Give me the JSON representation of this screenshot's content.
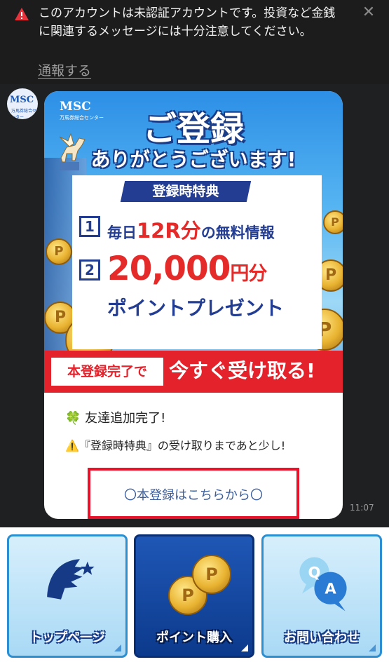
{
  "warning": {
    "message": "このアカウントは未認証アカウントです。投資など金銭に関連するメッセージには十分注意してください。",
    "report_link": "通報する",
    "icon": "warning-triangle-icon",
    "close_icon": "close-icon"
  },
  "chat": {
    "avatar": {
      "name": "MSC",
      "subtitle": "万馬券総合センター"
    },
    "banner": {
      "logo": "MSC",
      "logo_sub": "万馬券総合センター",
      "title": "ご登録",
      "subtitle": "ありがとうございます!",
      "perk_header": "登録時特典",
      "perk1_num": "1",
      "perk1_pre": "毎日",
      "perk1_highlight": "12R分",
      "perk1_post": "の無料情報",
      "perk2_num": "2",
      "perk2_amount": "20,000",
      "perk2_unit": "円分",
      "perk2_line2": "ポイントプレゼント",
      "cta_box": "本登録完了で",
      "cta_text": "今すぐ受け取る!",
      "coin_mark": "P"
    },
    "message_line1": "🍀 友達追加完了!",
    "message_line2": "⚠️『登録時特典』の受け取りまであと少し!",
    "register_button": "〇本登録はこちらから〇",
    "time": "11:07"
  },
  "menu": {
    "items": [
      {
        "label": "トップページ",
        "icon": "pegasus-logo-icon"
      },
      {
        "label": "ポイント購入",
        "icon": "coins-icon"
      },
      {
        "label": "お問い合わせ",
        "icon": "qa-bubbles-icon"
      }
    ]
  },
  "colors": {
    "banner_blue": "#2d8fe6",
    "brand_navy": "#233d93",
    "accent_red": "#e3222b",
    "highlight_border": "#e8132a"
  }
}
